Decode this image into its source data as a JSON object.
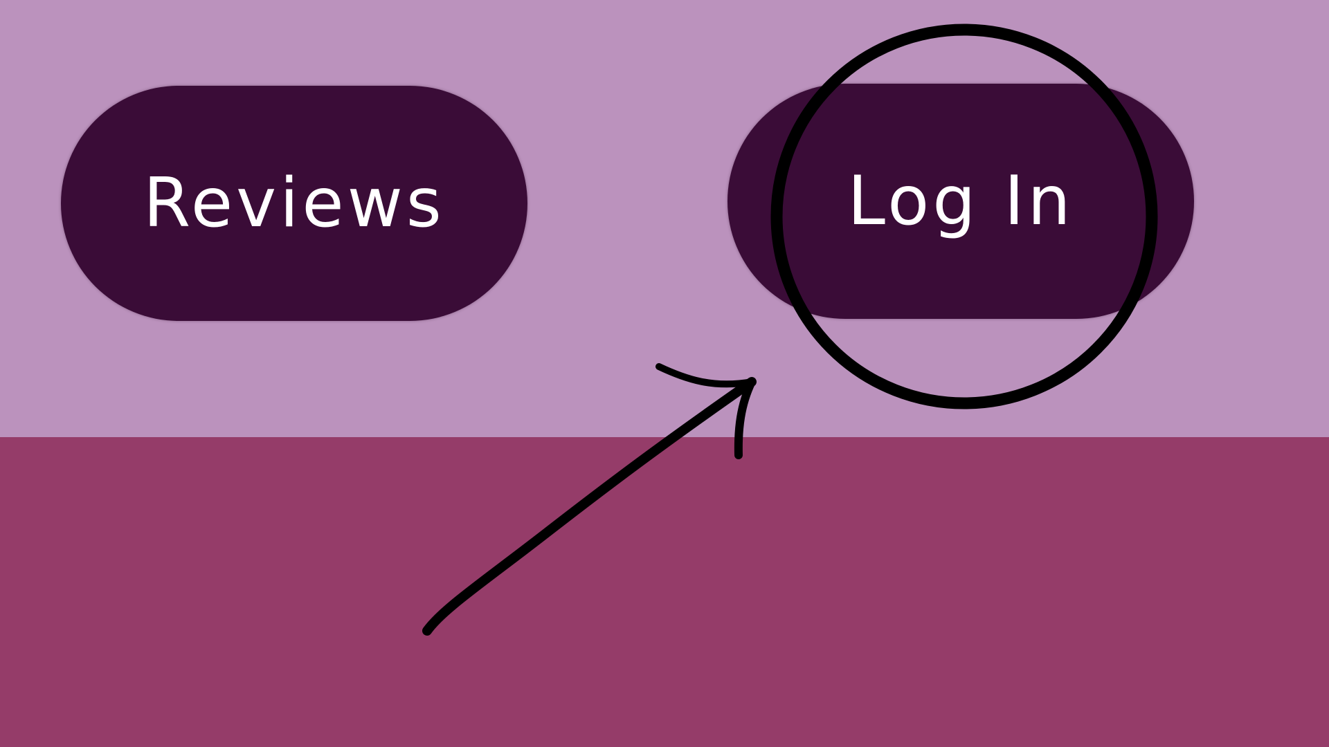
{
  "colors": {
    "header_background": "#bb92bd",
    "page_background": "#953c69",
    "button_background": "#3a0c37",
    "button_text": "#ffffff",
    "annotation_stroke": "#000000"
  },
  "nav": {
    "reviews_label": "Reviews",
    "login_label": "Log In"
  },
  "annotations": {
    "highlight_target": "login-button",
    "highlight_shape": "hand-drawn circle",
    "pointer_shape": "hand-drawn arrow"
  }
}
